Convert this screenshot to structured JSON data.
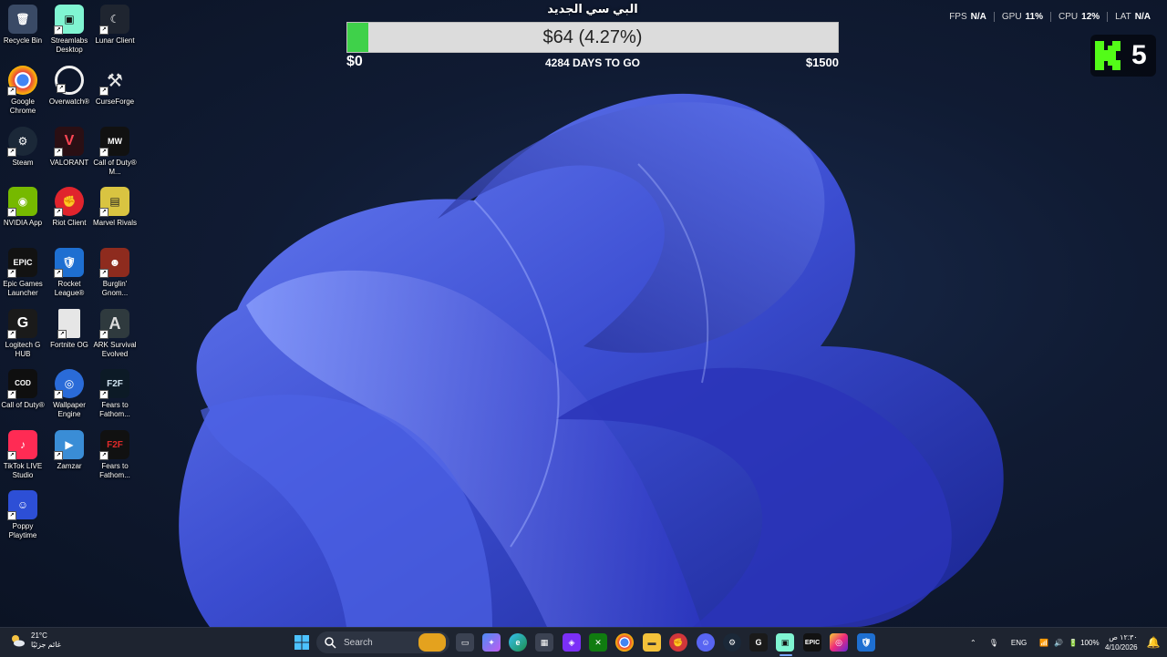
{
  "desktop_icons": [
    {
      "label": "Recycle Bin",
      "icon": "recycle-bin-icon",
      "color": "#3a4a66"
    },
    {
      "label": "Streamlabs Desktop",
      "icon": "streamlabs-icon",
      "color": "#80f5d2"
    },
    {
      "label": "Lunar Client",
      "icon": "lunar-client-icon",
      "color": "#1f2530"
    },
    {
      "label": "Google Chrome",
      "icon": "chrome-icon",
      "color": "#e8453c"
    },
    {
      "label": "Overwatch®",
      "icon": "overwatch-icon",
      "color": "#f0f0f0"
    },
    {
      "label": "CurseForge",
      "icon": "curseforge-icon",
      "color": "#24262b"
    },
    {
      "label": "Steam",
      "icon": "steam-icon",
      "color": "#1b2838"
    },
    {
      "label": "VALORANT",
      "icon": "valorant-icon",
      "color": "#ff4655"
    },
    {
      "label": "Call of Duty® M...",
      "icon": "mw3-icon",
      "color": "#111111"
    },
    {
      "label": "NVIDIA App",
      "icon": "nvidia-icon",
      "color": "#76b900"
    },
    {
      "label": "Riot Client",
      "icon": "riot-client-icon",
      "color": "#e0242d"
    },
    {
      "label": "Marvel Rivals",
      "icon": "marvel-rivals-icon",
      "color": "#d9c441"
    },
    {
      "label": "Epic Games Launcher",
      "icon": "epic-games-icon",
      "color": "#121212"
    },
    {
      "label": "Rocket League®",
      "icon": "rocket-league-icon",
      "color": "#1e6fd1"
    },
    {
      "label": "Burglin' Gnom...",
      "icon": "burglin-gnomes-icon",
      "color": "#8e2b1e"
    },
    {
      "label": "Logitech G HUB",
      "icon": "logitech-icon",
      "color": "#1a1a1a"
    },
    {
      "label": "Fortnite OG",
      "icon": "file-icon",
      "color": "#e6e6e6"
    },
    {
      "label": "ARK Survival Evolved",
      "icon": "ark-icon",
      "color": "#2f3a3e"
    },
    {
      "label": "Call of Duty®",
      "icon": "cod-icon",
      "color": "#0f0f0f"
    },
    {
      "label": "Wallpaper Engine",
      "icon": "wallpaper-engine-icon",
      "color": "#2a6bd8"
    },
    {
      "label": "Fears to Fathom...",
      "icon": "f2f-icon",
      "color": "#0c1a26"
    },
    {
      "label": "TikTok LIVE Studio",
      "icon": "tiktok-icon",
      "color": "#ff2b54"
    },
    {
      "label": "Zamzar",
      "icon": "zamzar-icon",
      "color": "#3a8dd6"
    },
    {
      "label": "Fears to Fathom...",
      "icon": "f2f-red-icon",
      "color": "#111111"
    },
    {
      "label": "Poppy Playtime",
      "icon": "poppy-playtime-icon",
      "color": "#2d4fd6"
    }
  ],
  "goal": {
    "title": "البي سي الجديد",
    "amount_text": "$64 (4.27%)",
    "progress_fraction": 0.0427,
    "min_label": "$0",
    "days_label": "4284 DAYS TO GO",
    "max_label": "$1500",
    "fill_color": "#3fd14a"
  },
  "perf": {
    "fps_label": "FPS",
    "fps_value": "N/A",
    "gpu_label": "GPU",
    "gpu_value": "11%",
    "cpu_label": "CPU",
    "cpu_value": "12%",
    "lat_label": "LAT",
    "lat_value": "N/A"
  },
  "kick": {
    "count": "5",
    "color": "#53fc18"
  },
  "taskbar": {
    "weather_temp": "21°C",
    "weather_desc": "غائم جزئيًا",
    "search_placeholder": "Search",
    "lang": "ENG",
    "battery": "100%",
    "time": "١٢:٣٠ ص",
    "date": "4/10/2026"
  }
}
